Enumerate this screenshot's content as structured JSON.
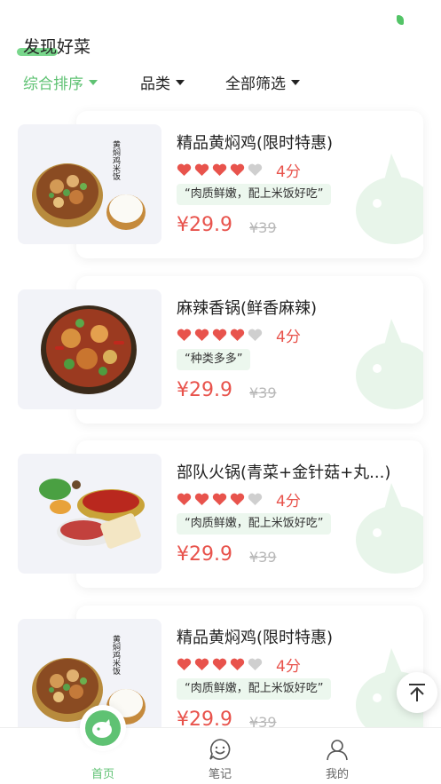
{
  "header": {
    "title": "发现好菜"
  },
  "sortbar": {
    "items": [
      {
        "label": "综合排序",
        "active": true
      },
      {
        "label": "品类",
        "active": false
      },
      {
        "label": "全部筛选",
        "active": false
      }
    ]
  },
  "dishes": [
    {
      "name": "精品黄焖鸡(限时特惠)",
      "rating": 4,
      "max_rating": 5,
      "score_label": "4分",
      "tag": "“肉质鲜嫩，配上米饭好吃”",
      "price": "¥29.9",
      "old_price": "¥39",
      "image": "braised-chicken-rice"
    },
    {
      "name": "麻辣香锅(鲜香麻辣)",
      "rating": 4,
      "max_rating": 5,
      "score_label": "4分",
      "tag": "“种类多多”",
      "price": "¥29.9",
      "old_price": "¥39",
      "image": "spicy-pot"
    },
    {
      "name": "部队火锅(青菜+金针菇+丸...)",
      "rating": 4,
      "max_rating": 5,
      "score_label": "4分",
      "tag": "“肉质鲜嫩，配上米饭好吃”",
      "price": "¥29.9",
      "old_price": "¥39",
      "image": "army-hotpot"
    },
    {
      "name": "精品黄焖鸡(限时特惠)",
      "rating": 4,
      "max_rating": 5,
      "score_label": "4分",
      "tag": "“肉质鲜嫩，配上米饭好吃”",
      "price": "¥29.9",
      "old_price": "¥39",
      "image": "braised-chicken-rice"
    }
  ],
  "braised_chicken_image_text": "黄焖鸡米饭",
  "tabbar": {
    "items": [
      {
        "label": "首页",
        "active": true,
        "icon": "home-logo-icon"
      },
      {
        "label": "笔记",
        "active": false,
        "icon": "chat-face-icon"
      },
      {
        "label": "我的",
        "active": false,
        "icon": "user-icon"
      }
    ]
  },
  "colors": {
    "accent": "#5fc273",
    "price": "#e8534c",
    "heart_on": "#e8534c",
    "heart_off": "#cfcfcf",
    "tag_bg": "#ecf7ee"
  }
}
